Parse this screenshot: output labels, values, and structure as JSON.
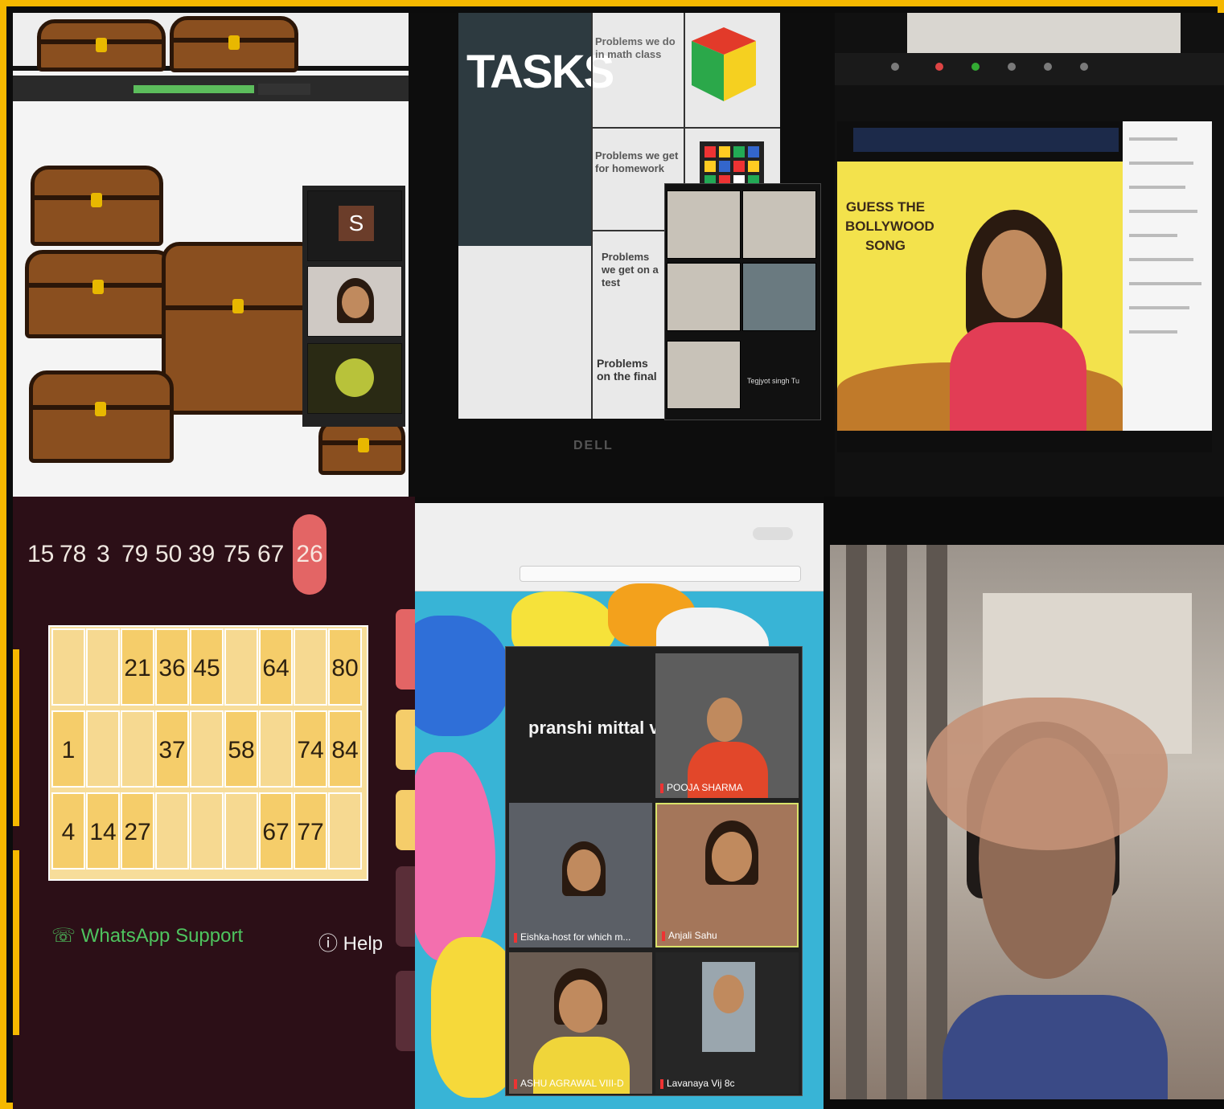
{
  "panels": {
    "chests": {
      "participant_initial": "S"
    },
    "tasks": {
      "title": "TASKS",
      "items": [
        "Problems we do in math class",
        "Problems we get for homework",
        "Problems we get on a test",
        "Problems on the final"
      ],
      "participant_name": "Tegjyot singh Tu",
      "laptop_brand": "DELL"
    },
    "bollywood": {
      "slide_title": "GUESS THE BOLLYWOOD SONG"
    },
    "tambola": {
      "called_numbers": [
        "15",
        "78",
        "3",
        "79",
        "50",
        "39",
        "75",
        "67"
      ],
      "current_number": "26",
      "ticket_rows": [
        [
          "",
          "",
          "21",
          "36",
          "45",
          "",
          "64",
          "",
          "80"
        ],
        [
          "1",
          "",
          "",
          "37",
          "",
          "58",
          "",
          "74",
          "84"
        ],
        [
          "4",
          "14",
          "27",
          "",
          "",
          "",
          "67",
          "77",
          ""
        ]
      ],
      "whatsapp_label": "WhatsApp Support",
      "help_label": "Help"
    },
    "zoom": {
      "active_speaker": "pranshi  mittal  v...",
      "participants": [
        "POOJA SHARMA",
        "Eishka-host for which m...",
        "Anjali Sahu",
        "ASHU AGRAWAL VIII-D",
        "Lavanaya Vij 8c"
      ]
    }
  },
  "colors": {
    "border": "#f5b800",
    "tambola_bg": "#2c0f17",
    "ticket_cell": "#f5cd6a",
    "current_ball": "#e36565",
    "whatsapp": "#4ec35e"
  }
}
